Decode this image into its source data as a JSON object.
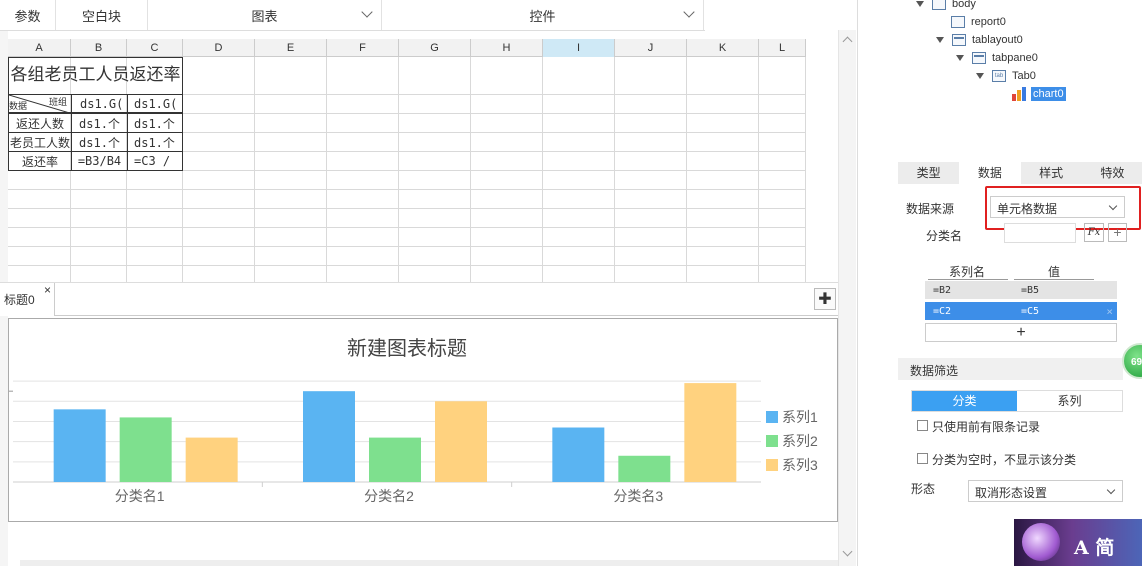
{
  "toolbar": {
    "params": "参数",
    "blank": "空白块",
    "chart": "图表",
    "control": "控件"
  },
  "sheet": {
    "columns": [
      "A",
      "B",
      "C",
      "D",
      "E",
      "F",
      "G",
      "H",
      "I",
      "J",
      "K",
      "L"
    ],
    "title": "各组老员工人员返还率",
    "header_row": {
      "slash_top": "班组",
      "slash_bottom": "数据",
      "b": "ds1.G(",
      "c": "ds1.G("
    },
    "rows": [
      {
        "label": "返还人数",
        "b": "ds1.个",
        "c": "ds1.个"
      },
      {
        "label": "老员工人数",
        "b": "ds1.个",
        "c": "ds1.个"
      },
      {
        "label": "返还率",
        "b": "=B3/B4",
        "c": "=C3 /"
      }
    ]
  },
  "tabstrip": {
    "tab_label": "标题0",
    "close": "×"
  },
  "chart_data": {
    "type": "bar",
    "title": "新建图表标题",
    "categories": [
      "分类名1",
      "分类名2",
      "分类名3"
    ],
    "series": [
      {
        "name": "系列1",
        "values": [
          3.6,
          4.5,
          2.7
        ],
        "color": "#5ab4f2"
      },
      {
        "name": "系列2",
        "values": [
          3.2,
          2.2,
          1.3
        ],
        "color": "#7ee08e"
      },
      {
        "name": "系列3",
        "values": [
          2.2,
          4.0,
          4.9
        ],
        "color": "#ffd27f"
      }
    ],
    "ylim": [
      0,
      5.5
    ],
    "grid": true,
    "legend": "right"
  },
  "tree": {
    "body": "body",
    "report": "report0",
    "tablayout": "tablayout0",
    "tabpane": "tabpane0",
    "tab": "Tab0",
    "tab_icon": "tab",
    "chart": "chart0"
  },
  "panel": {
    "tabs": [
      "类型",
      "数据",
      "样式",
      "特效"
    ],
    "active_tab": 1,
    "data_source_label": "数据来源",
    "data_source_value": "单元格数据",
    "category_name_label": "分类名",
    "fx": "Fx",
    "series_header": "系列名",
    "value_header": "值",
    "series_rows": [
      {
        "name": "=B2",
        "value": "=B5"
      },
      {
        "name": "=C2",
        "value": "=C5"
      }
    ],
    "add": "+",
    "filter_label": "数据筛选",
    "seg_category": "分类",
    "seg_series": "系列",
    "limit_records": "只使用前有限条记录",
    "hide_empty": "分类为空时，不显示该分类",
    "form_label": "形态",
    "form_value": "取消形态设置",
    "badge": "69",
    "promo_text": "A 简"
  }
}
